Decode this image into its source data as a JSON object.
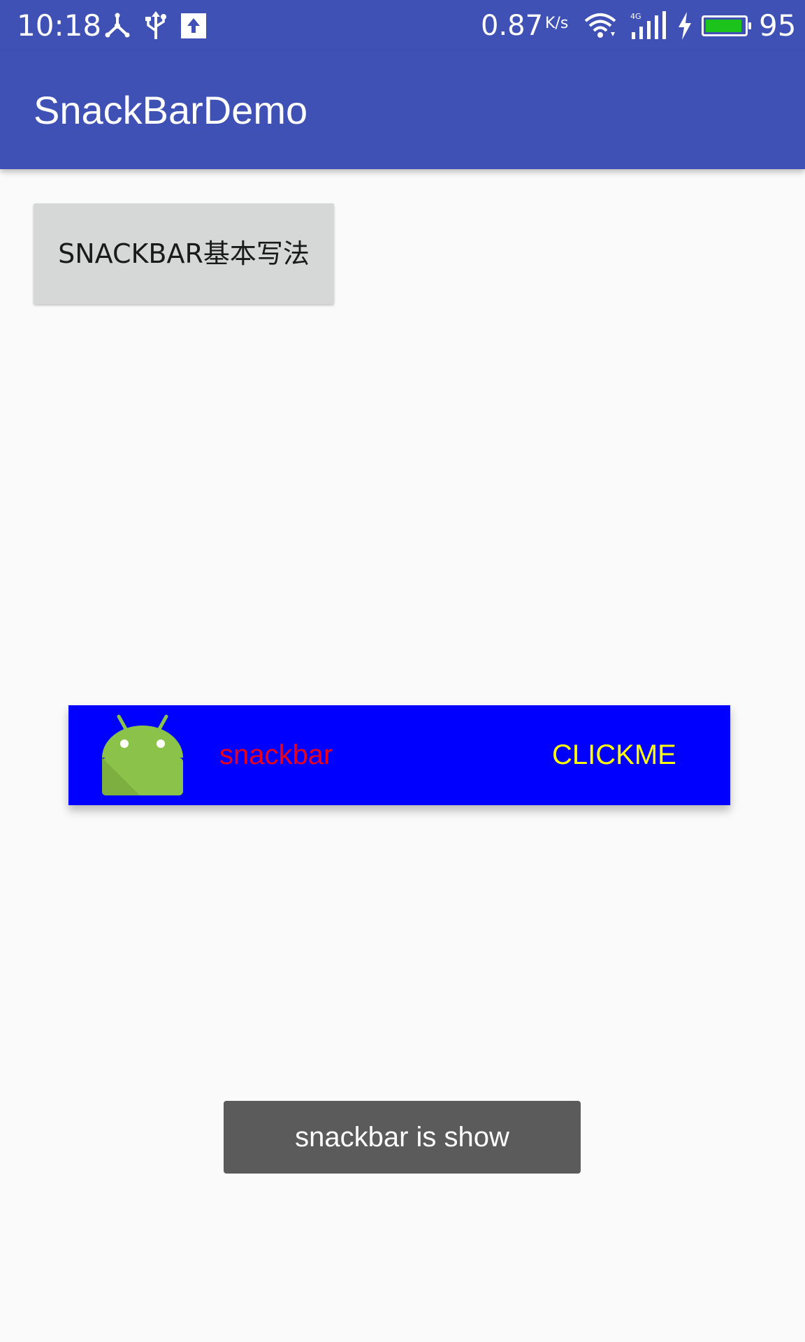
{
  "status_bar": {
    "time": "10:18",
    "speed": "0.87",
    "speed_unit": "K/s",
    "network": "4G",
    "battery_level": 95,
    "battery_text": "95",
    "icons": [
      "usb-tethering-icon",
      "usb-icon",
      "upload-icon",
      "wifi-icon",
      "signal-icon",
      "charging-icon",
      "battery-icon"
    ]
  },
  "app_bar": {
    "title": "SnackBarDemo"
  },
  "main": {
    "basic_button_label": "SNACKBAR基本写法"
  },
  "snackbar": {
    "icon": "android-icon",
    "message": "snackbar",
    "action_label": "CLICKME"
  },
  "toast": {
    "message": "snackbar is show"
  },
  "colors": {
    "primary": "#3f51b5",
    "background": "#fafafa",
    "button_bg": "#d6d7d7",
    "snackbar_bg": "#0000ff",
    "snackbar_text": "#e8001c",
    "snackbar_action": "#ffff00",
    "toast_bg": "#5b5b5b",
    "android_green": "#8bc34a",
    "battery_green": "#1bc31b"
  }
}
